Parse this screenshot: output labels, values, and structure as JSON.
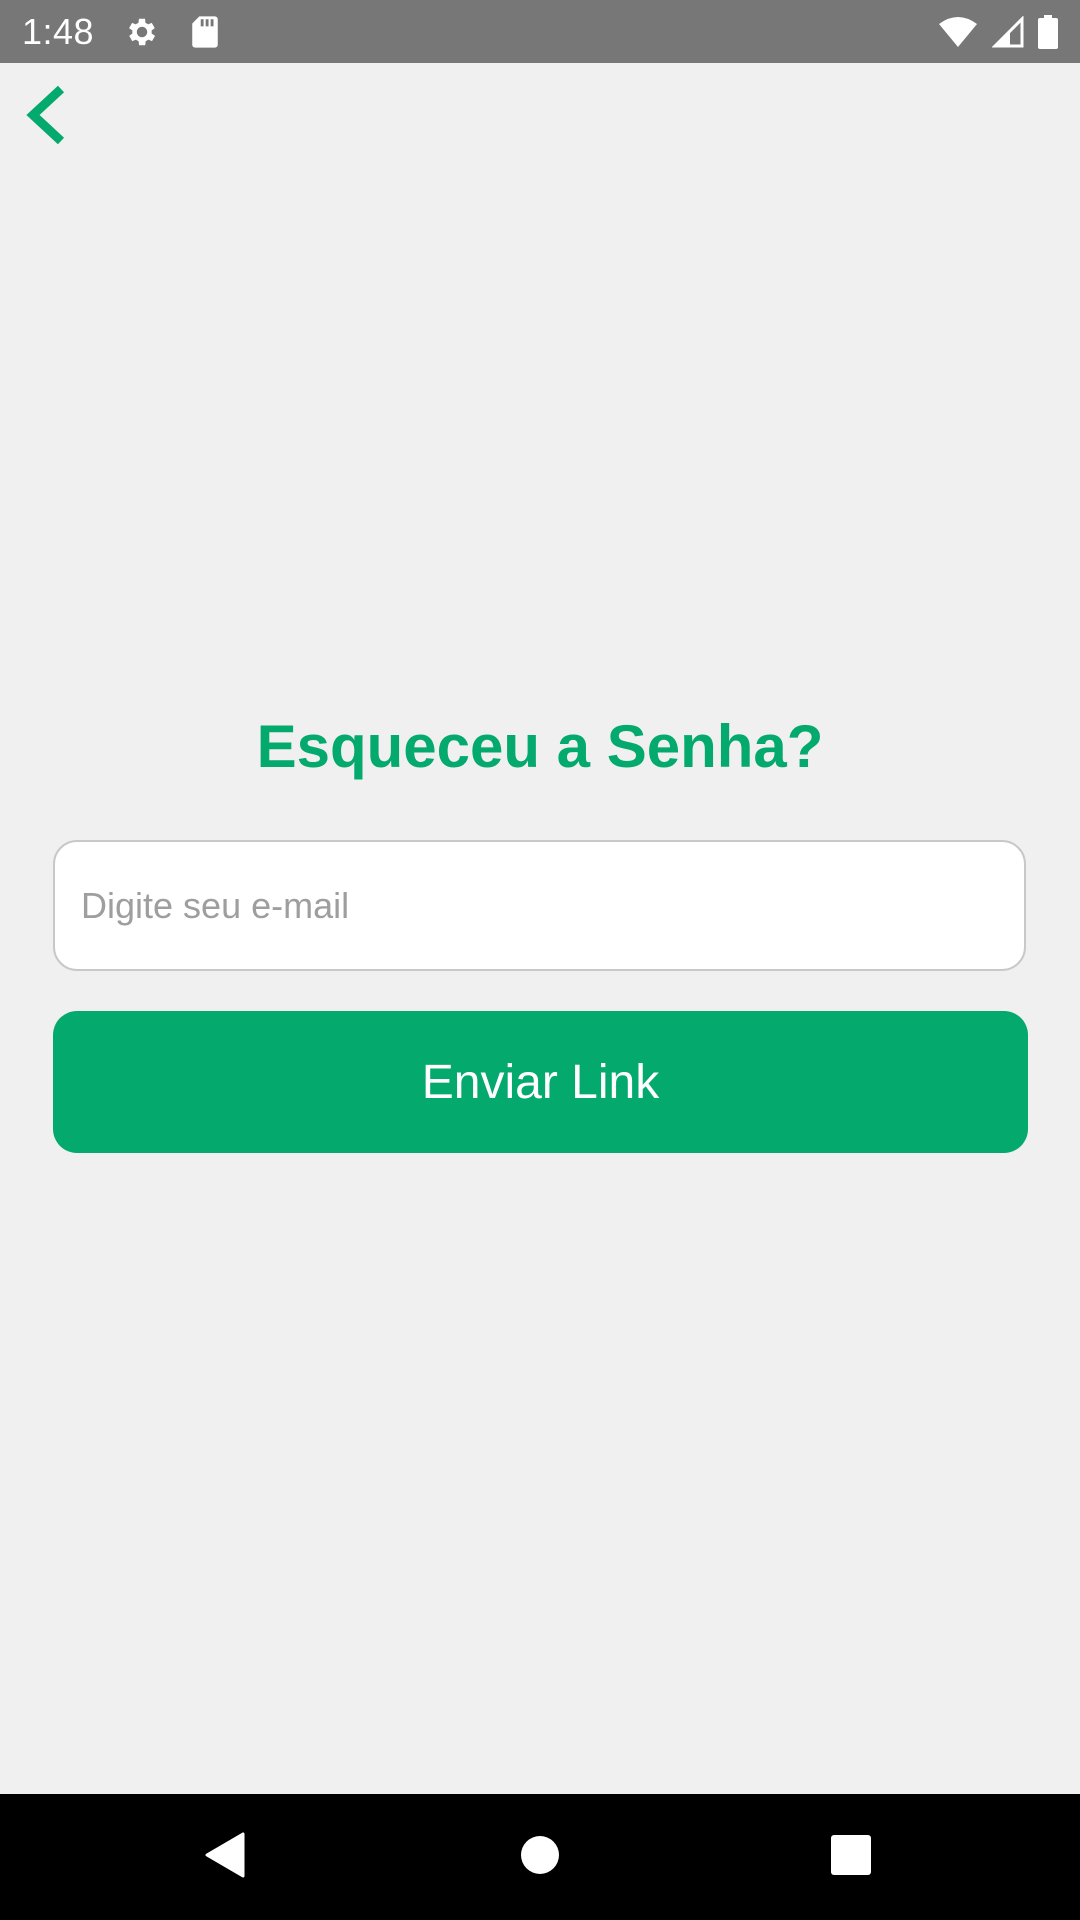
{
  "status_bar": {
    "time": "1:48",
    "left_icons": [
      "gear-icon",
      "sd-card-icon"
    ],
    "right_icons": [
      "wifi-icon",
      "signal-icon",
      "battery-icon"
    ]
  },
  "header": {
    "back_icon": "chevron-left-icon"
  },
  "form": {
    "title": "Esqueceu a Senha?",
    "email_placeholder": "Digite seu e-mail",
    "email_value": "",
    "submit_label": "Enviar Link"
  },
  "nav_bar": {
    "buttons": [
      "back-triangle-icon",
      "home-circle-icon",
      "recents-square-icon"
    ]
  },
  "colors": {
    "accent": "#04a96e",
    "background": "#f0f0f0",
    "status_bar": "#777777",
    "nav_bar": "#000000"
  }
}
